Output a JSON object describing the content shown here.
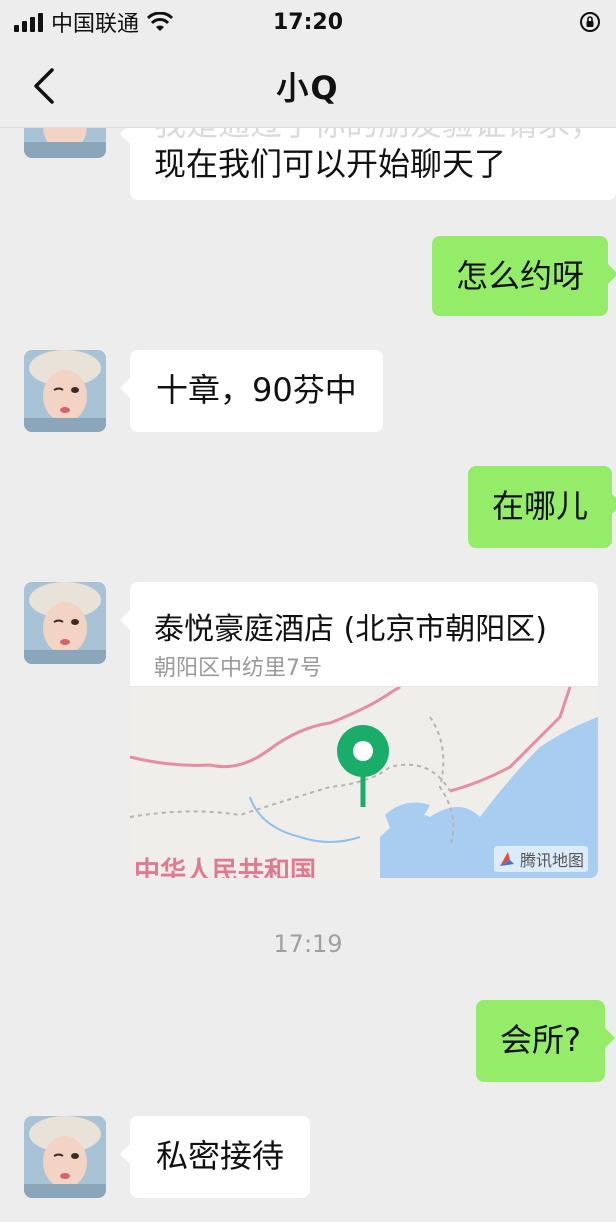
{
  "status_bar": {
    "carrier": "中国联通",
    "time": "17:20"
  },
  "nav": {
    "title": "小Q"
  },
  "messages": [
    {
      "direction": "in",
      "text_line1": "我是通过了你的朋友验证请求，",
      "text_line2": "现在我们可以开始聊天了"
    },
    {
      "direction": "out",
      "text": "怎么约呀"
    },
    {
      "direction": "in",
      "text": "十章，90芬中"
    },
    {
      "direction": "out",
      "text": "在哪儿"
    },
    {
      "direction": "in",
      "type": "location",
      "name": "泰悦豪庭酒店 (北京市朝阳区)",
      "address": "朝阳区中纺里7号",
      "map_label": "中华人民共和国",
      "map_credit": "腾讯地图"
    },
    {
      "direction": "out",
      "text": "会所?"
    },
    {
      "direction": "in",
      "text": "私密接待"
    }
  ],
  "timestamp": "17:19",
  "colors": {
    "background": "#ededed",
    "outgoing_bubble": "#95ec69",
    "incoming_bubble": "#ffffff",
    "map_pin": "#1aad6a"
  }
}
